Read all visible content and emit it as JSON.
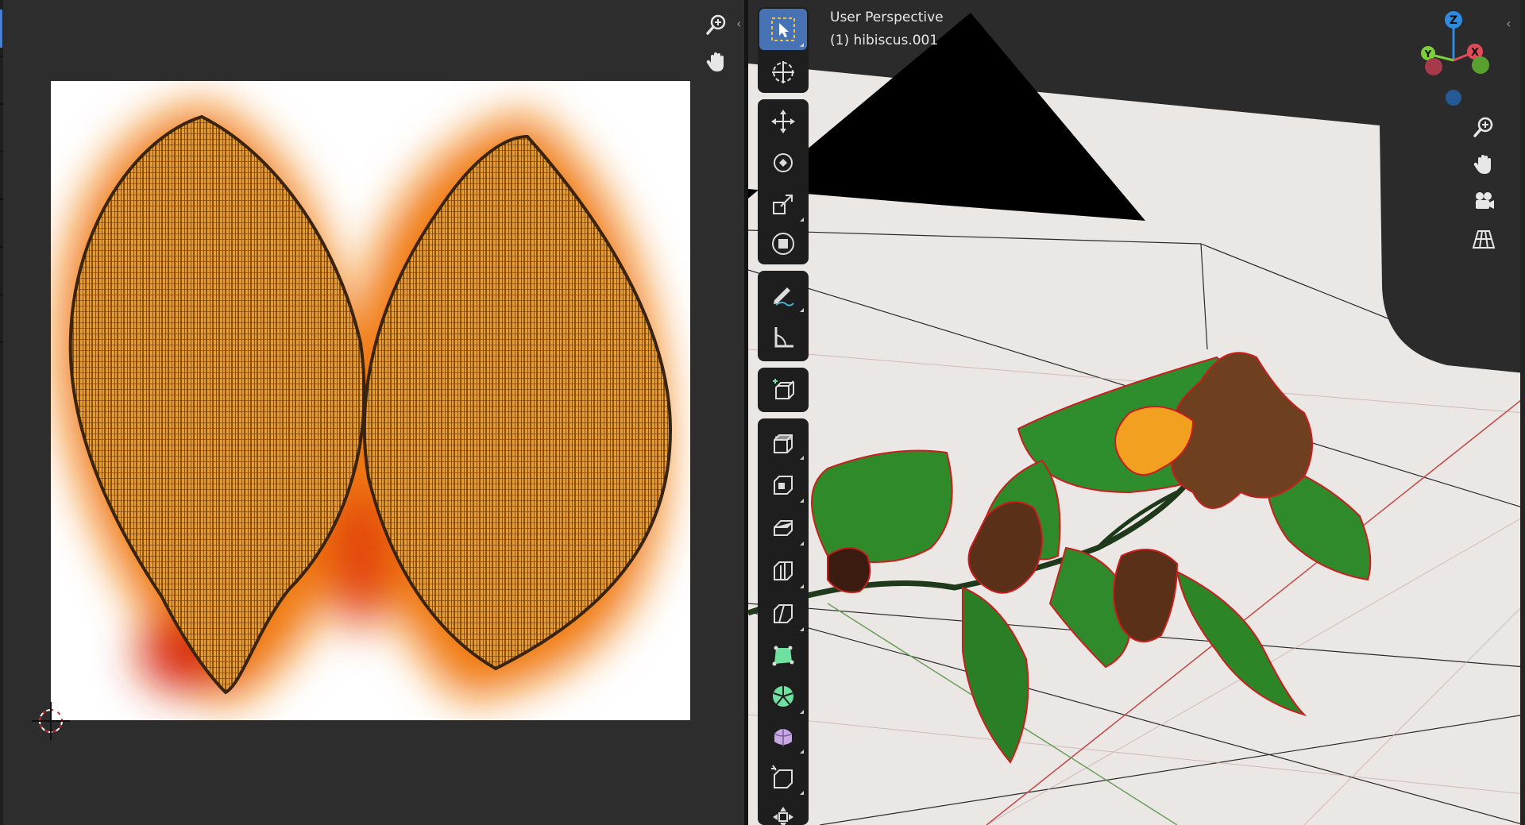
{
  "viewport": {
    "label_line1": "User Perspective",
    "label_line2": "(1) hibiscus.001"
  },
  "uv_editor": {
    "nav_icons": [
      "zoom-icon",
      "pan-hand-icon"
    ],
    "background_color": "#2d2d2d"
  },
  "toolbar": {
    "tools": [
      "select-box",
      "cursor",
      "move",
      "rotate",
      "scale",
      "transform",
      "annotate",
      "measure",
      "add-cube",
      "extrude-region",
      "inset-faces",
      "bevel",
      "loop-cut",
      "knife",
      "poly-build",
      "spin",
      "smooth",
      "edge-slide",
      "shrink-fatten"
    ],
    "active_tool": "select-box",
    "active_color": "#4772b3"
  },
  "gizmo": {
    "axes": [
      "Z",
      "Y",
      "X"
    ],
    "colors": {
      "x": "#e24a5a",
      "y": "#7ccf3b",
      "z": "#2f8be0"
    }
  },
  "viewport_nav_icons": [
    "zoom-icon",
    "pan-hand-icon",
    "camera-icon",
    "grid-perspective-icon"
  ],
  "colors": {
    "accent": "#4772b3",
    "uv_orange": "#f08a10",
    "leaf_green": "#2f8a2a",
    "edge_red": "#d02020"
  }
}
